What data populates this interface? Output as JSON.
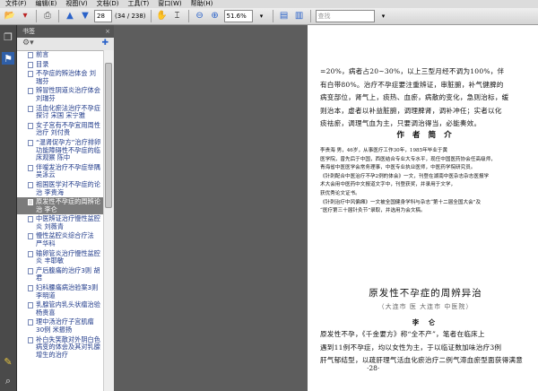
{
  "menu": [
    "文件(F)",
    "编辑(E)",
    "视图(V)",
    "文档(D)",
    "工具(T)",
    "窗口(W)",
    "帮助(H)"
  ],
  "toolbar": {
    "page_current": "28",
    "page_total": "(34 / 238)",
    "zoom": "51.6%",
    "search_placeholder": "查找"
  },
  "panel": {
    "title": "书签",
    "bookmarks": [
      "前言",
      "目录",
      "不孕症的辨治体会 刘瑞芬",
      "辨冒性阴道炎治疗体会 刘瑞芬",
      "活血化瘀法治疗不孕症探讨 宋国 宋宁雅",
      "女子宫有不孕宜用周性治疗 刘付贵",
      "“温肾促孕方”治疗排卵功能障碍性不孕症的临床观察 陈中",
      "伴嗳发治疗不孕症举隅 吴泳云",
      "祖国医学对不孕症的论治 李贵海",
      "原发性不孕症的周辨论治 李仑",
      "中医辨证治疗慢性盆腔炎 刘薇青",
      "慢性盆腔炎综合疗法 严华科",
      "输卵管炎治疗慢性盆腔炎 丰耶敏",
      "产后腹痛的治疗3则 胡君",
      "妇科腰痛病治验案3则 李明道",
      "乳腺管内乳头状瘤治验 杨贵喜",
      "理中汤治疗子宫肌瘤30例 米振扬",
      "补白失笑散对外阴白色病变的体会及其对乳腺增生的治疗"
    ]
  },
  "doc": {
    "para_top": [
      "=20%，病者占20~30%，以上三型月经不调为100%，伴",
      "有白带80%。治疗不孕症要注重辨证，审脏腑，补气健脾的",
      "病变部位，肾气上，痰热、血瘀，病散的变化，急则治标，缓",
      "则治本，虚者以补益脏腑，调理脾肾，调补冲任；实者以化",
      "痰祛瘀，调理气血为主，只要调治得当，必能奏效。"
    ],
    "author_heading": "作 者 简 介",
    "author_lines": [
      "李贵海 男，46岁，从事医疗工作30年，1985年毕业于黄",
      "医学院，曾先后于中国，西医结合专业大专水平，现任中国医药协会任高级师，",
      "青海省中医医学会常务理事，中医专业执业医师，中医药学院研究员。",
      "《针刺配合中医治疗不孕2例的体会》一文，刊登在湖南中医杂志杂志医报学",
      "术大会用中医药中文报道文字中，刊登获奖，并录用于文学，",
      "获优秀论文证书。",
      "《针刺治疗中风偏瘫》一文被全国健身学科与杂志“第十二届全国大会”及",
      "“医疗第三十届针灸节”录取，并选用为会文稿。"
    ],
    "chapter_title": "原发性不孕症的周辨异治",
    "chapter_subtitle": "（大连市 医 大连市 中医院）",
    "section_heading": "李 仑",
    "para_bottom": [
      "原发性不孕，《千金要方》称“全不产”，笔者在临床上",
      "遇到11例不孕症，均以女性为主，于以临证数加味治疗3例",
      "肝气郁结型，以疏肝理气活血化瘀治疗二例气滞血瘀型面获得满意"
    ],
    "page_number": "·28·"
  }
}
